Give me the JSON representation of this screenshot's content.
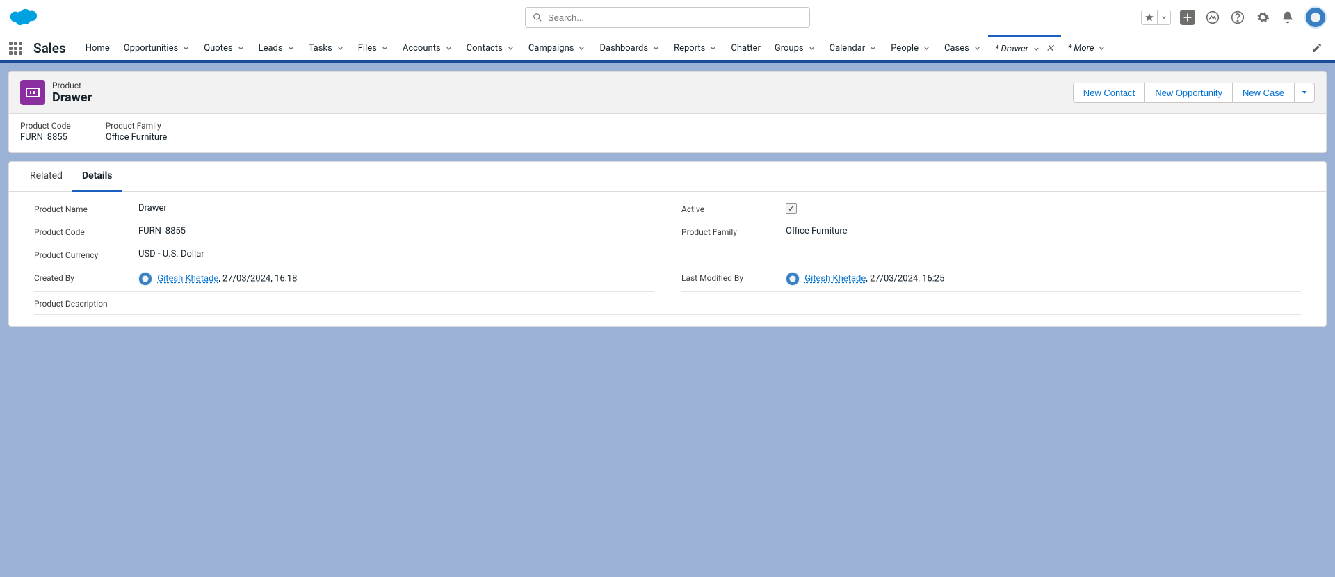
{
  "search": {
    "placeholder": "Search..."
  },
  "appName": "Sales",
  "nav": {
    "items": [
      {
        "label": "Home",
        "dd": false
      },
      {
        "label": "Opportunities",
        "dd": true
      },
      {
        "label": "Quotes",
        "dd": true
      },
      {
        "label": "Leads",
        "dd": true
      },
      {
        "label": "Tasks",
        "dd": true
      },
      {
        "label": "Files",
        "dd": true
      },
      {
        "label": "Accounts",
        "dd": true
      },
      {
        "label": "Contacts",
        "dd": true
      },
      {
        "label": "Campaigns",
        "dd": true
      },
      {
        "label": "Dashboards",
        "dd": true
      },
      {
        "label": "Reports",
        "dd": true
      },
      {
        "label": "Chatter",
        "dd": false
      },
      {
        "label": "Groups",
        "dd": true
      },
      {
        "label": "Calendar",
        "dd": true
      },
      {
        "label": "People",
        "dd": true
      },
      {
        "label": "Cases",
        "dd": true
      }
    ],
    "activeTab": "* Drawer",
    "more": "* More"
  },
  "record": {
    "type": "Product",
    "name": "Drawer",
    "actions": {
      "new_contact": "New Contact",
      "new_opportunity": "New Opportunity",
      "new_case": "New Case"
    },
    "highlights": {
      "code_label": "Product Code",
      "code_val": "FURN_8855",
      "family_label": "Product Family",
      "family_val": "Office Furniture"
    }
  },
  "tabs": {
    "related": "Related",
    "details": "Details"
  },
  "details": {
    "product_name_label": "Product Name",
    "product_name": "Drawer",
    "active_label": "Active",
    "product_code_label": "Product Code",
    "product_code": "FURN_8855",
    "product_family_label": "Product Family",
    "product_family": "Office Furniture",
    "product_currency_label": "Product Currency",
    "product_currency": "USD - U.S. Dollar",
    "created_by_label": "Created By",
    "created_by_user": "Gitesh Khetade",
    "created_by_time": ", 27/03/2024, 16:18",
    "modified_by_label": "Last Modified By",
    "modified_by_user": "Gitesh Khetade",
    "modified_by_time": ", 27/03/2024, 16:25",
    "description_label": "Product Description"
  }
}
